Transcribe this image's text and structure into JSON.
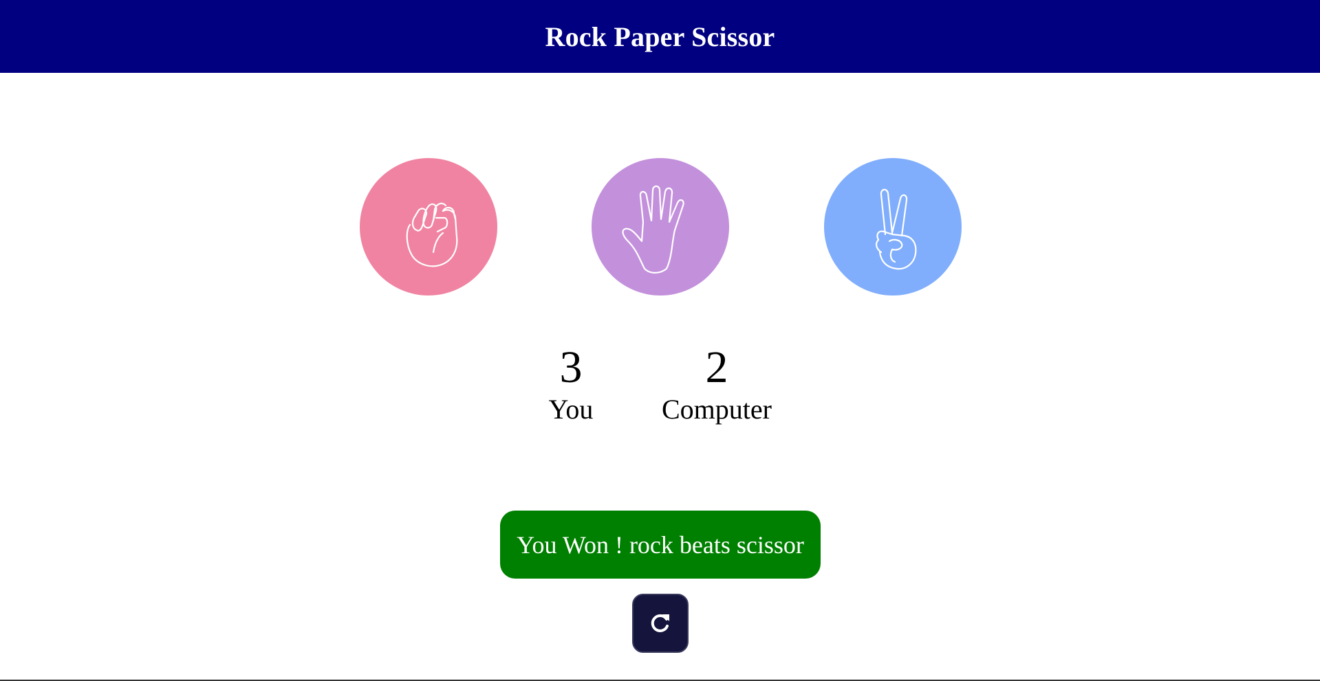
{
  "header": {
    "title": "Rock Paper Scissor",
    "background": "#000080"
  },
  "choices": [
    {
      "id": "rock",
      "icon": "fist-icon",
      "color": "#f083a2"
    },
    {
      "id": "paper",
      "icon": "open-hand-icon",
      "color": "#c390dc"
    },
    {
      "id": "scissor",
      "icon": "victory-hand-icon",
      "color": "#80aefc"
    }
  ],
  "scoreboard": {
    "user": {
      "score": "3",
      "label": "You"
    },
    "computer": {
      "score": "2",
      "label": "Computer"
    }
  },
  "result": {
    "message": "You Won ! rock beats scissor",
    "color": "#008000"
  },
  "reset_button": {
    "icon": "refresh-icon",
    "color": "#14143c"
  }
}
